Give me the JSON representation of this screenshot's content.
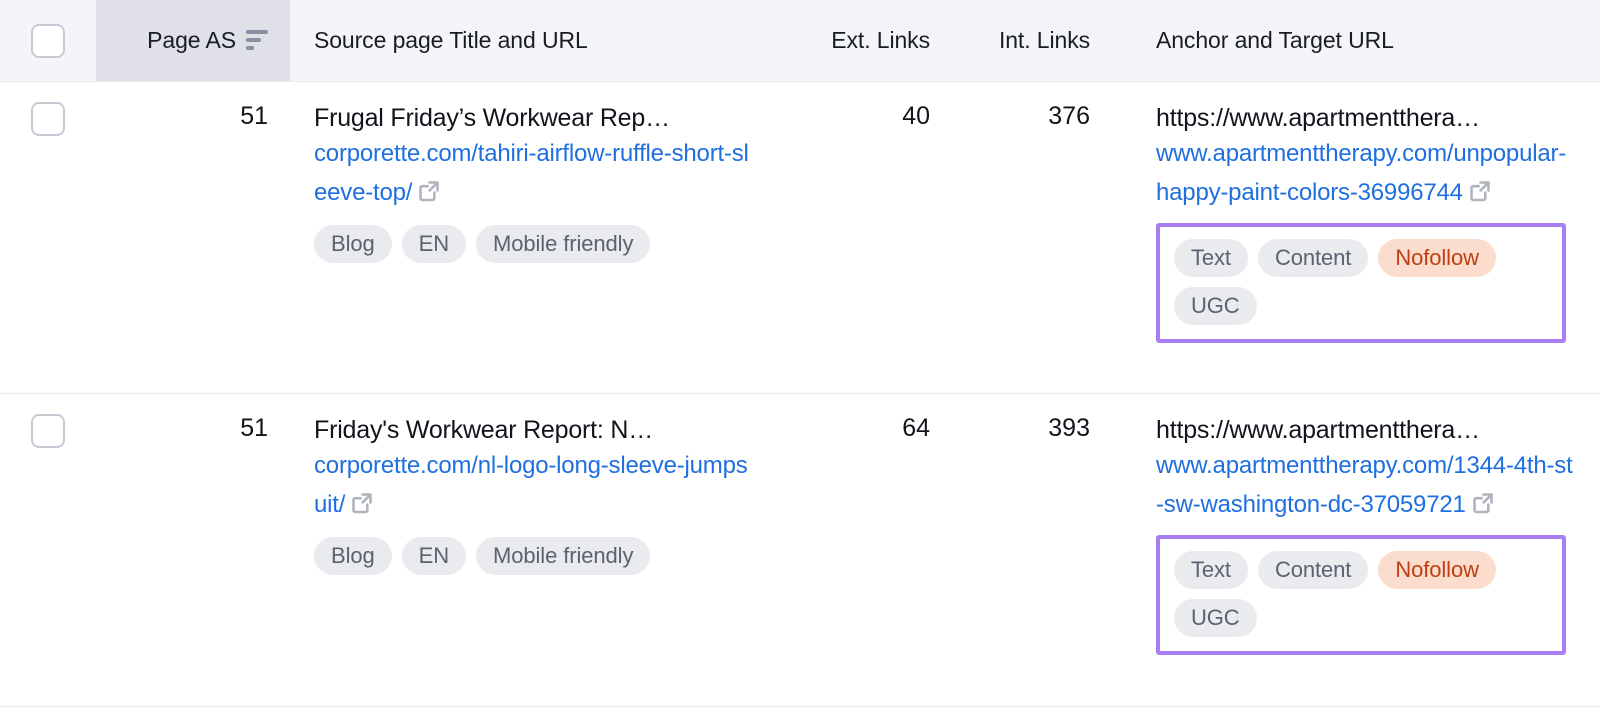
{
  "table": {
    "columns": [
      {
        "key": "select",
        "label": "",
        "icon": "checkbox-icon"
      },
      {
        "key": "page_as",
        "label": "Page AS",
        "sorted": true,
        "sort_icon": "sort-descending-icon"
      },
      {
        "key": "source",
        "label": "Source page Title and URL"
      },
      {
        "key": "ext",
        "label": "Ext. Links"
      },
      {
        "key": "int",
        "label": "Int. Links"
      },
      {
        "key": "anchor",
        "label": "Anchor and Target URL"
      }
    ],
    "rows": [
      {
        "page_as": "51",
        "source_title": "Frugal Friday’s Workwear Rep…",
        "source_url": "corporette.com/tahiri-airflow-ruffle-short-sleeve-top/",
        "source_link_icon": "external-link-icon",
        "source_tags": [
          {
            "label": "Blog",
            "style": "neutral"
          },
          {
            "label": "EN",
            "style": "neutral"
          },
          {
            "label": "Mobile friendly",
            "style": "neutral"
          }
        ],
        "ext_links": "40",
        "int_links": "376",
        "anchor_text": "https://www.apartmentthera…",
        "target_url": "www.apartmenttherapy.com/unpopular-happy-paint-colors-36996744",
        "target_link_icon": "external-link-icon",
        "link_attributes": [
          {
            "label": "Text",
            "style": "neutral"
          },
          {
            "label": "Content",
            "style": "neutral"
          },
          {
            "label": "Nofollow",
            "style": "nofollow"
          },
          {
            "label": "UGC",
            "style": "neutral"
          }
        ],
        "attributes_highlighted": true
      },
      {
        "page_as": "51",
        "source_title": "Friday's Workwear Report: N…",
        "source_url": "corporette.com/nl-logo-long-sleeve-jumpsuit/",
        "source_link_icon": "external-link-icon",
        "source_tags": [
          {
            "label": "Blog",
            "style": "neutral"
          },
          {
            "label": "EN",
            "style": "neutral"
          },
          {
            "label": "Mobile friendly",
            "style": "neutral"
          }
        ],
        "ext_links": "64",
        "int_links": "393",
        "anchor_text": "https://www.apartmentthera…",
        "target_url": "www.apartmenttherapy.com/1344-4th-st-sw-washington-dc-37059721",
        "target_link_icon": "external-link-icon",
        "link_attributes": [
          {
            "label": "Text",
            "style": "neutral"
          },
          {
            "label": "Content",
            "style": "neutral"
          },
          {
            "label": "Nofollow",
            "style": "nofollow"
          },
          {
            "label": "UGC",
            "style": "neutral"
          }
        ],
        "attributes_highlighted": true
      }
    ]
  },
  "colors": {
    "header_bg": "#f4f5f8",
    "sorted_column_bg": "#dfe0e8",
    "link": "#1f6fe0",
    "pill_bg": "#eaebef",
    "pill_text": "#5b6270",
    "nofollow_bg": "#fbddcd",
    "nofollow_text": "#c03e12",
    "highlight_border": "#a87ef2",
    "row_border": "#e9eaef",
    "text": "#12141c"
  }
}
